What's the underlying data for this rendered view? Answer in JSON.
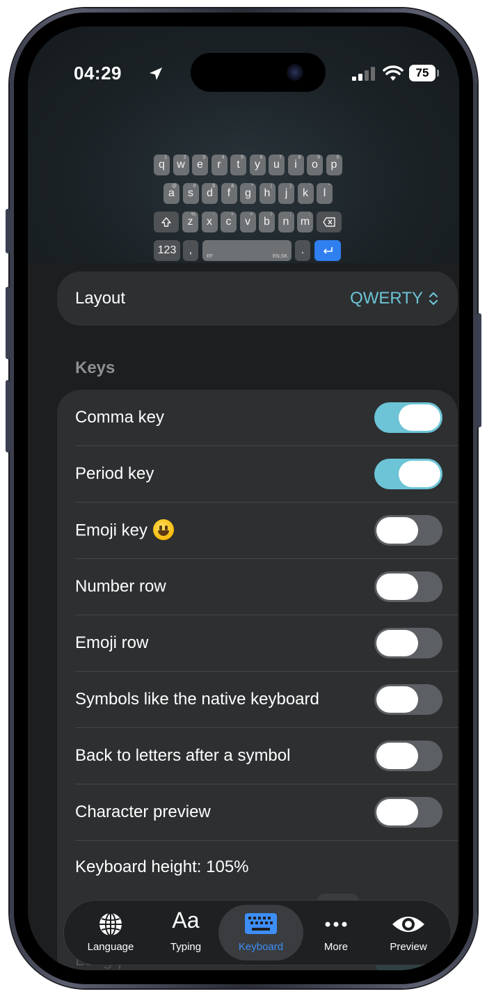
{
  "status": {
    "time": "04:29",
    "battery": "75"
  },
  "keyboard_preview": {
    "row1": [
      {
        "k": "q",
        "h": "1"
      },
      {
        "k": "w",
        "h": "2"
      },
      {
        "k": "e",
        "h": "3"
      },
      {
        "k": "r",
        "h": "4"
      },
      {
        "k": "t",
        "h": "5"
      },
      {
        "k": "y",
        "h": "6"
      },
      {
        "k": "u",
        "h": "7"
      },
      {
        "k": "i",
        "h": "8"
      },
      {
        "k": "o",
        "h": "9"
      },
      {
        "k": "p",
        "h": "0"
      }
    ],
    "row2": [
      {
        "k": "a",
        "h": "@"
      },
      {
        "k": "s",
        "h": "#"
      },
      {
        "k": "d",
        "h": "$"
      },
      {
        "k": "f",
        "h": "&"
      },
      {
        "k": "g",
        "h": "*"
      },
      {
        "k": "h",
        "h": "("
      },
      {
        "k": "j",
        "h": ")"
      },
      {
        "k": "k",
        "h": "'"
      },
      {
        "k": "l",
        "h": "\""
      }
    ],
    "row3": [
      {
        "k": "z",
        "h": "%"
      },
      {
        "k": "x",
        "h": "-"
      },
      {
        "k": "c",
        "h": "+"
      },
      {
        "k": "v",
        "h": "="
      },
      {
        "k": "b",
        "h": "/"
      },
      {
        "k": "n",
        "h": ";"
      },
      {
        "k": "m",
        "h": ":"
      }
    ],
    "numbers_key": "123",
    "comma_key": ",",
    "space_left_tag": "EF",
    "space_right_tag": "EN,SK",
    "period_key": "."
  },
  "layout": {
    "label": "Layout",
    "value": "QWERTY"
  },
  "keys_section": {
    "title": "Keys",
    "rows": [
      {
        "label": "Comma key",
        "on": true
      },
      {
        "label": "Period key",
        "on": true
      },
      {
        "label": "Emoji key",
        "on": false
      },
      {
        "label": "Number row",
        "on": false
      },
      {
        "label": "Emoji row",
        "on": false
      },
      {
        "label": "Symbols like the native keyboard",
        "on": false
      },
      {
        "label": "Back to letters after a symbol",
        "on": false
      },
      {
        "label": "Character preview",
        "on": false
      }
    ],
    "keyboard_height": "Keyboard height: 105%",
    "faded_row": "Long-press hints in the corner"
  },
  "tabbar": {
    "tabs": [
      {
        "label": "Language",
        "icon": "globe-icon"
      },
      {
        "label": "Typing",
        "icon": "text-aa-icon",
        "glyph": "Aa"
      },
      {
        "label": "Keyboard",
        "icon": "keyboard-icon",
        "active": true
      },
      {
        "label": "More",
        "icon": "ellipsis-icon"
      },
      {
        "label": "Preview",
        "icon": "eye-icon"
      }
    ]
  },
  "colors": {
    "accent": "#6cc4d6",
    "tab_active": "#3e8ef7",
    "enter_key": "#2f7ff0"
  }
}
